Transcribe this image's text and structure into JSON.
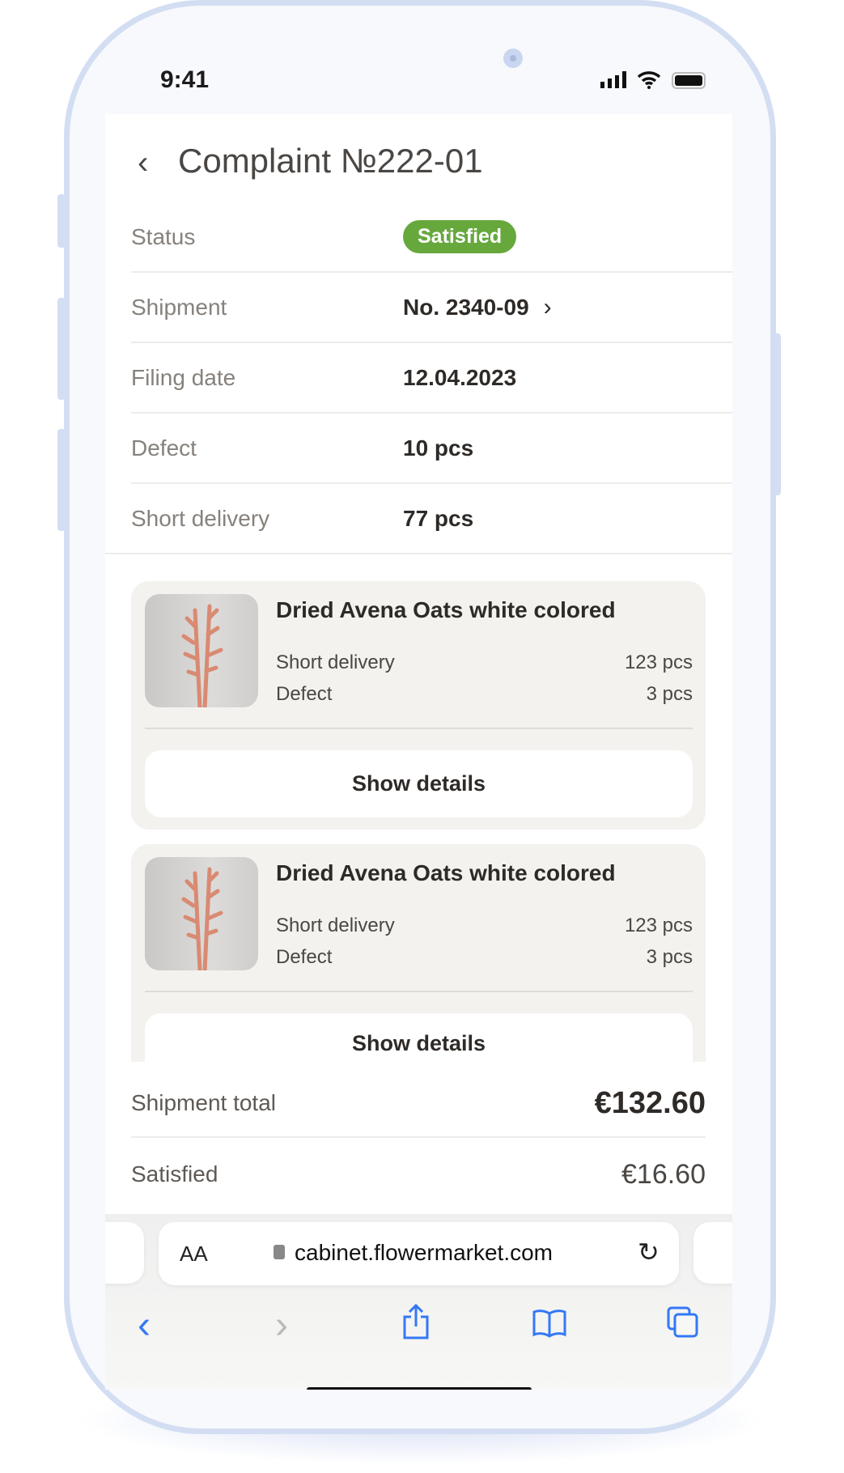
{
  "status_bar": {
    "time": "9:41"
  },
  "header": {
    "title": "Complaint №222-01"
  },
  "details": [
    {
      "label": "Status",
      "value": "Satisfied",
      "type": "badge"
    },
    {
      "label": "Shipment",
      "value": "No. 2340-09"
    },
    {
      "label": "Filing date",
      "value": "12.04.2023"
    },
    {
      "label": "Defect",
      "value": "10 pcs"
    },
    {
      "label": "Short delivery",
      "value": "77 pcs"
    }
  ],
  "items": [
    {
      "title": "Dried Avena Oats white colored",
      "short_label": "Short delivery",
      "short_value": "123 pcs",
      "defect_label": "Defect",
      "defect_value": "3 pcs",
      "button": "Show details"
    },
    {
      "title": "Dried Avena Oats white colored",
      "short_label": "Short delivery",
      "short_value": "123 pcs",
      "defect_label": "Defect",
      "defect_value": "3 pcs",
      "button": "Show details"
    }
  ],
  "summary": {
    "total_label": "Shipment total",
    "total_value": "€132.60",
    "satisfied_label": "Satisfied",
    "satisfied_value": "€16.60"
  },
  "browser": {
    "text_size": "AA",
    "url": "cabinet.flowermarket.com"
  },
  "colors": {
    "status_green": "#67a83d",
    "safari_blue": "#3478f6",
    "frame": "#d3def3"
  }
}
